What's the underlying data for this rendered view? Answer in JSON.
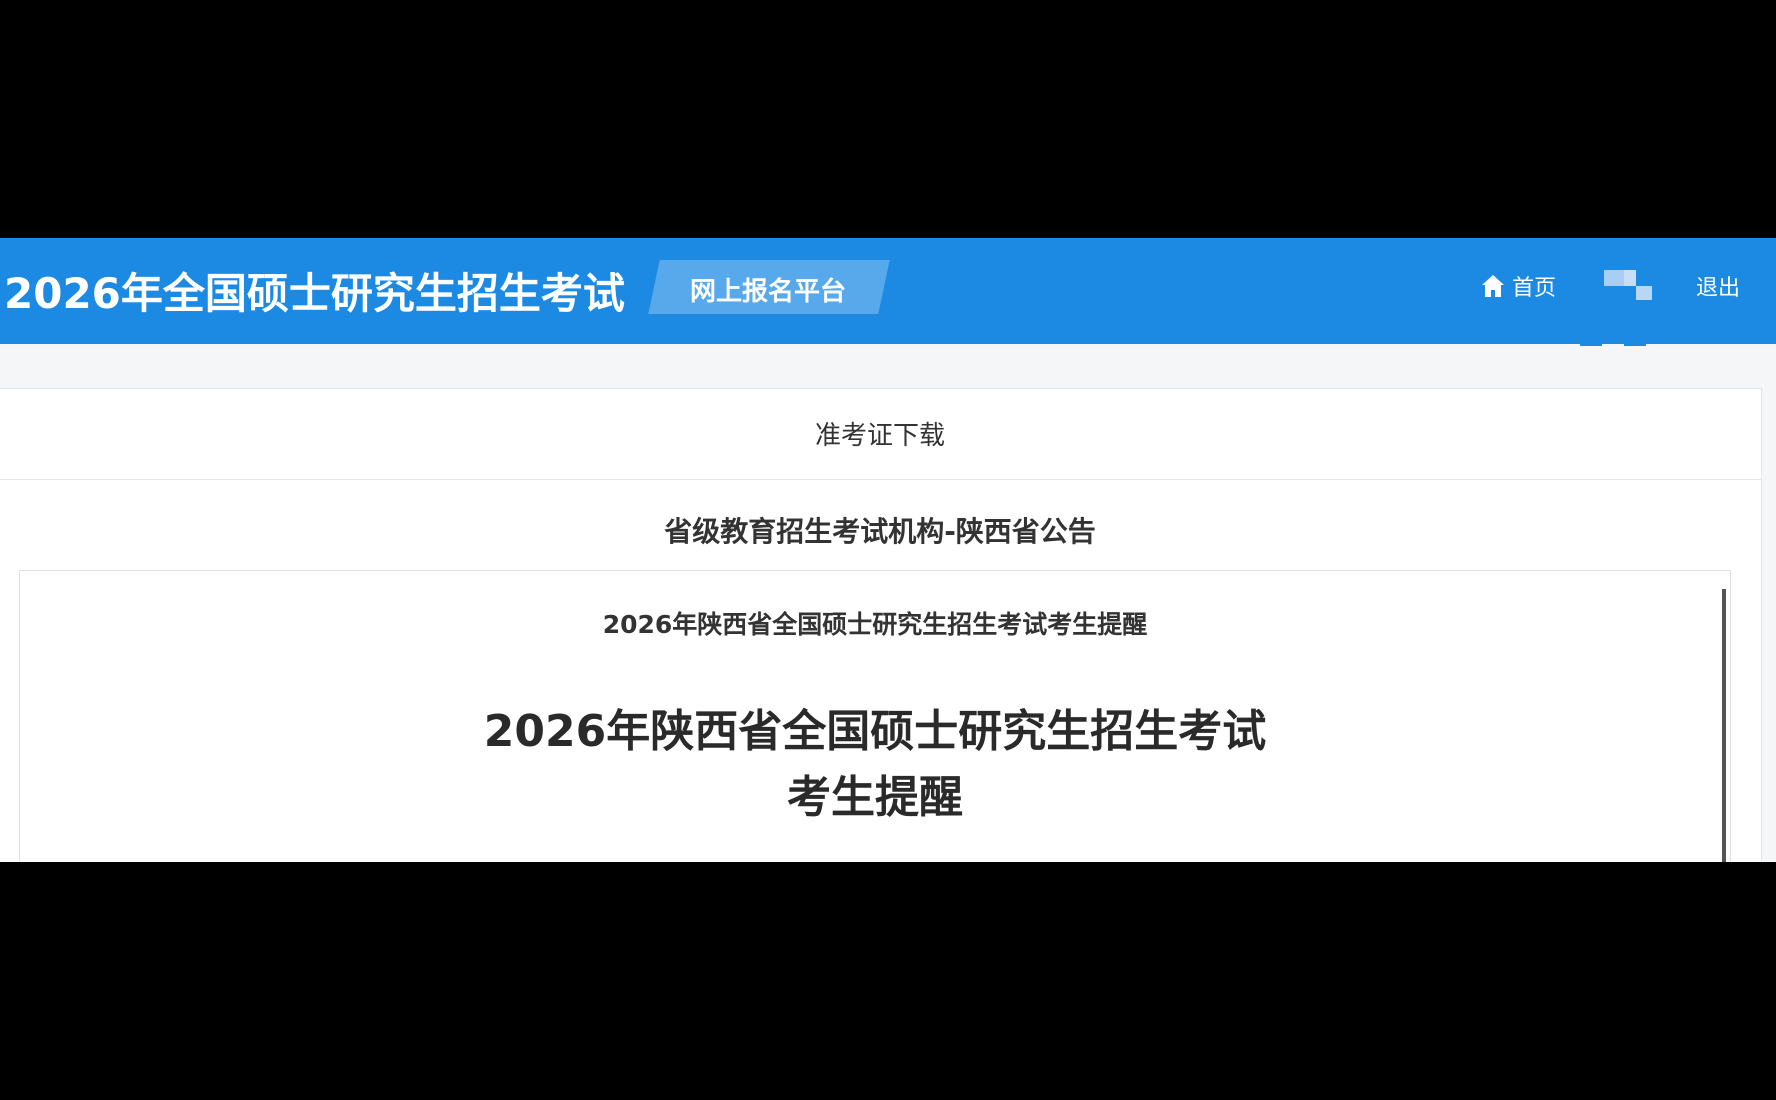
{
  "header": {
    "site_title": "2026年全国硕士研究生招生考试",
    "platform_tag": "网上报名平台",
    "nav": {
      "home_label": "首页",
      "logout_label": "退出"
    }
  },
  "tab": {
    "title": "准考证下载"
  },
  "announcement": {
    "heading": "省级教育招生考试机构-陕西省公告",
    "notice_title": "2026年陕西省全国硕士研究生招生考试考生提醒",
    "notice_big_line1": "2026年陕西省全国硕士研究生招生考试",
    "notice_big_line2": "考生提醒"
  },
  "colors": {
    "header_bg": "#1c8ae3",
    "tag_bg": "#58a9ec",
    "page_bg": "#f5f6f8"
  },
  "icons": {
    "home": "home-icon"
  }
}
